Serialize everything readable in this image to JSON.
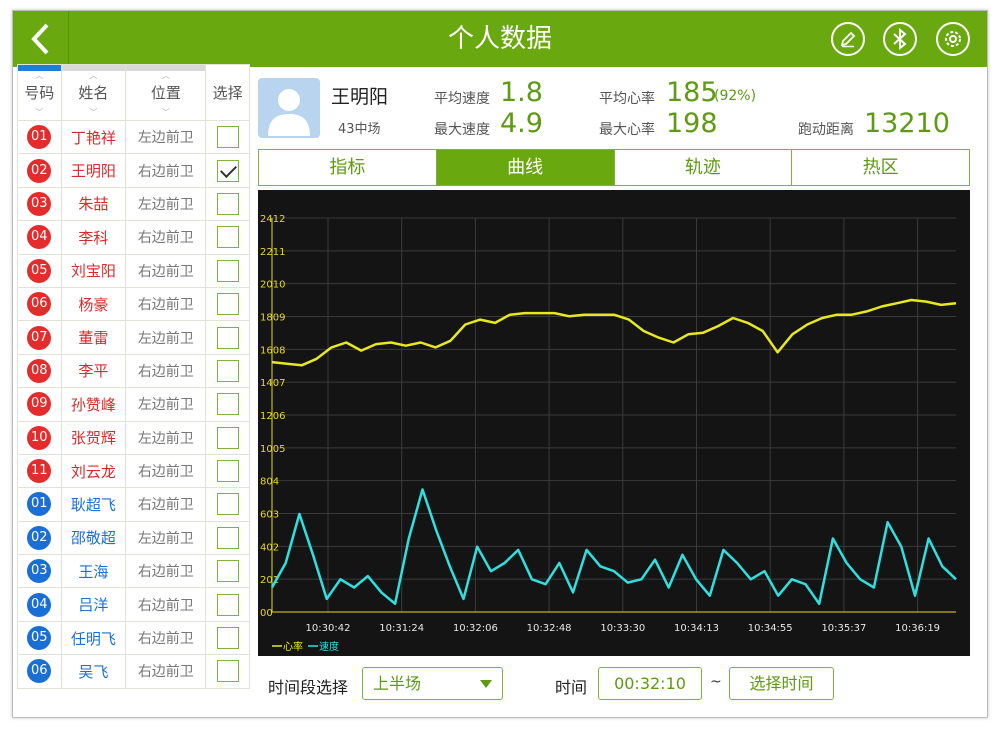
{
  "header": {
    "title": "个人数据"
  },
  "roster": {
    "headers": [
      "号码",
      "姓名",
      "位置",
      "选择"
    ],
    "players": [
      {
        "num": "01",
        "name": "丁艳祥",
        "pos": "左边前卫",
        "team": "red",
        "checked": false
      },
      {
        "num": "02",
        "name": "王明阳",
        "pos": "右边前卫",
        "team": "red",
        "checked": true
      },
      {
        "num": "03",
        "name": "朱喆",
        "pos": "左边前卫",
        "team": "red",
        "checked": false
      },
      {
        "num": "04",
        "name": "李科",
        "pos": "右边前卫",
        "team": "red",
        "checked": false
      },
      {
        "num": "05",
        "name": "刘宝阳",
        "pos": "右边前卫",
        "team": "red",
        "checked": false
      },
      {
        "num": "06",
        "name": "杨豪",
        "pos": "右边前卫",
        "team": "red",
        "checked": false
      },
      {
        "num": "07",
        "name": "董雷",
        "pos": "左边前卫",
        "team": "red",
        "checked": false
      },
      {
        "num": "08",
        "name": "李平",
        "pos": "右边前卫",
        "team": "red",
        "checked": false
      },
      {
        "num": "09",
        "name": "孙赞峰",
        "pos": "左边前卫",
        "team": "red",
        "checked": false
      },
      {
        "num": "10",
        "name": "张贺辉",
        "pos": "左边前卫",
        "team": "red",
        "checked": false
      },
      {
        "num": "11",
        "name": "刘云龙",
        "pos": "右边前卫",
        "team": "red",
        "checked": false
      },
      {
        "num": "01",
        "name": "耿超飞",
        "pos": "右边前卫",
        "team": "blue",
        "checked": false
      },
      {
        "num": "02",
        "name": "邵敬超",
        "pos": "左边前卫",
        "team": "blue",
        "checked": false
      },
      {
        "num": "03",
        "name": "王海",
        "pos": "右边前卫",
        "team": "blue",
        "checked": false
      },
      {
        "num": "04",
        "name": "吕洋",
        "pos": "右边前卫",
        "team": "blue",
        "checked": false
      },
      {
        "num": "05",
        "name": "任明飞",
        "pos": "右边前卫",
        "team": "blue",
        "checked": false
      },
      {
        "num": "06",
        "name": "吴飞",
        "pos": "右边前卫",
        "team": "blue",
        "checked": false
      }
    ]
  },
  "profile": {
    "name": "王明阳",
    "team": "43中场",
    "avg_speed_label": "平均速度",
    "avg_speed": "1.8",
    "max_speed_label": "最大速度",
    "max_speed": "4.9",
    "avg_hr_label": "平均心率",
    "avg_hr": "185",
    "avg_hr_pct": "(92%)",
    "max_hr_label": "最大心率",
    "max_hr": "198",
    "distance_label": "跑动距离",
    "distance": "13210"
  },
  "tabs": [
    "指标",
    "曲线",
    "轨迹",
    "热区"
  ],
  "active_tab": 1,
  "chart_data": {
    "type": "line",
    "x": [
      "10:30:42",
      "10:31:24",
      "10:32:06",
      "10:32:48",
      "10:33:30",
      "10:34:13",
      "10:34:55",
      "10:35:37",
      "10:36:19"
    ],
    "y_ticks": [
      "00",
      "201",
      "402",
      "603",
      "804",
      "1005",
      "1206",
      "1407",
      "1608",
      "1809",
      "2010",
      "2211",
      "2412"
    ],
    "ylim": [
      0,
      2412
    ],
    "grid": true,
    "legend": [
      "心率",
      "速度"
    ],
    "series": [
      {
        "name": "心率",
        "color": "#e8e81e",
        "values": [
          1530,
          1520,
          1510,
          1550,
          1620,
          1650,
          1600,
          1640,
          1650,
          1630,
          1650,
          1620,
          1660,
          1760,
          1790,
          1770,
          1820,
          1830,
          1830,
          1830,
          1810,
          1820,
          1820,
          1820,
          1790,
          1720,
          1680,
          1650,
          1700,
          1710,
          1750,
          1800,
          1770,
          1720,
          1590,
          1700,
          1760,
          1800,
          1820,
          1820,
          1840,
          1870,
          1890,
          1910,
          1900,
          1880,
          1890
        ]
      },
      {
        "name": "速度",
        "color": "#2fe0e0",
        "values": [
          150,
          300,
          600,
          350,
          80,
          200,
          150,
          220,
          120,
          50,
          450,
          750,
          500,
          280,
          80,
          400,
          250,
          300,
          380,
          200,
          170,
          300,
          120,
          380,
          280,
          250,
          180,
          200,
          320,
          150,
          350,
          200,
          100,
          380,
          300,
          200,
          250,
          100,
          200,
          170,
          50,
          450,
          300,
          200,
          150,
          550,
          400,
          100,
          450,
          280,
          200
        ]
      }
    ]
  },
  "controls": {
    "period_label": "时间段选择",
    "period_value": "上半场",
    "time_label": "时间",
    "time_value": "00:32:10",
    "tilde": "~",
    "pick_button": "选择时间"
  },
  "icons": [
    "back-icon",
    "edit-icon",
    "bluetooth-icon",
    "settings-icon",
    "person-icon"
  ],
  "colors": {
    "accent": "#6aa80f",
    "red_team": "#e52c2c",
    "blue_team": "#1a6fd6",
    "hr_line": "#e8e81e",
    "speed_line": "#2fe0e0"
  }
}
